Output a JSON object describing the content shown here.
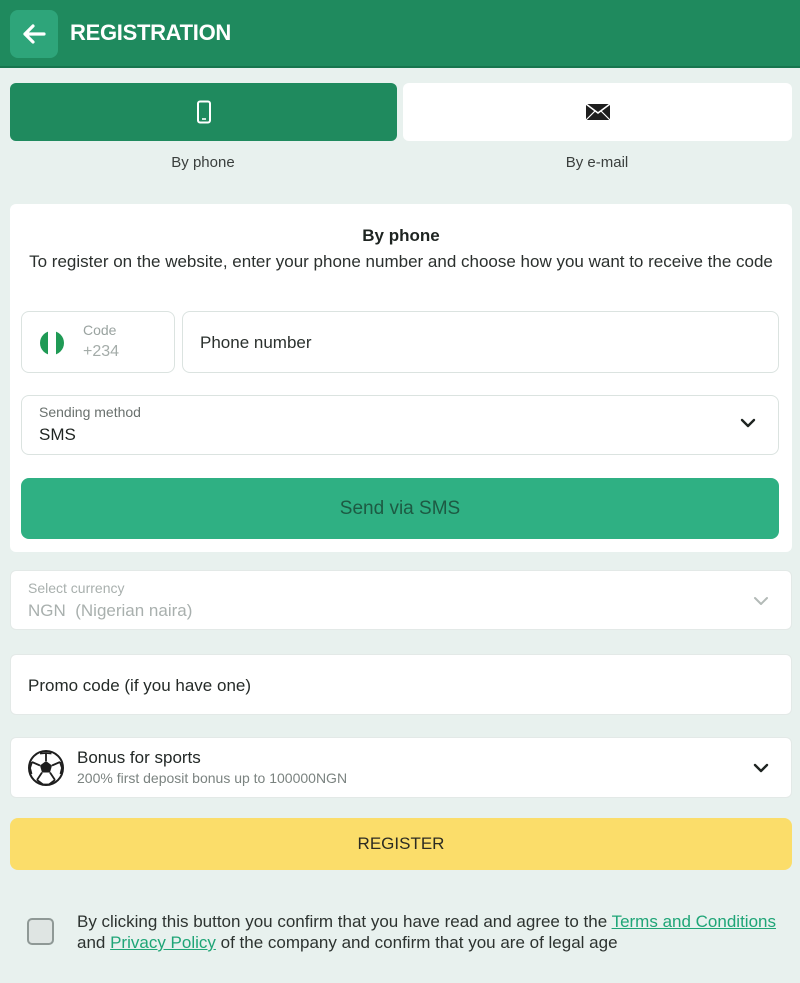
{
  "header": {
    "title": "REGISTRATION",
    "back_icon": "arrow-left-icon"
  },
  "tabs": [
    {
      "label": "By phone",
      "icon": "smartphone-icon",
      "active": true
    },
    {
      "label": "By e-mail",
      "icon": "envelope-icon",
      "active": false
    }
  ],
  "phone_form": {
    "title": "By phone",
    "description": "To register on the website, enter your phone number and choose how you want to receive the code",
    "code_label": "Code",
    "code_value": "+234",
    "flag_icon": "nigeria-flag-icon",
    "phone_placeholder": "Phone number",
    "sending_method_label": "Sending method",
    "sending_method_value": "SMS",
    "send_button": "Send via SMS"
  },
  "currency": {
    "label": "Select currency",
    "value": "NGN  (Nigerian naira)"
  },
  "promo": {
    "placeholder": "Promo code (if you have one)"
  },
  "bonus": {
    "title": "Bonus for sports",
    "subtitle": "200% first deposit bonus up to 100000NGN",
    "icon": "soccer-ball-icon"
  },
  "register_button": "REGISTER",
  "consent": {
    "text_1": "By clicking this button you confirm that you have read and agree to the ",
    "terms_link": "Terms and Conditions",
    "text_2": " and ",
    "privacy_link": "Privacy Policy",
    "text_3": " of the company and confirm that you are of legal age",
    "checked": false
  },
  "colors": {
    "brand_green": "#1f8a5e",
    "accent_green": "#2fb083",
    "register_yellow": "#fbdd6a",
    "background": "#e8f1ee"
  }
}
